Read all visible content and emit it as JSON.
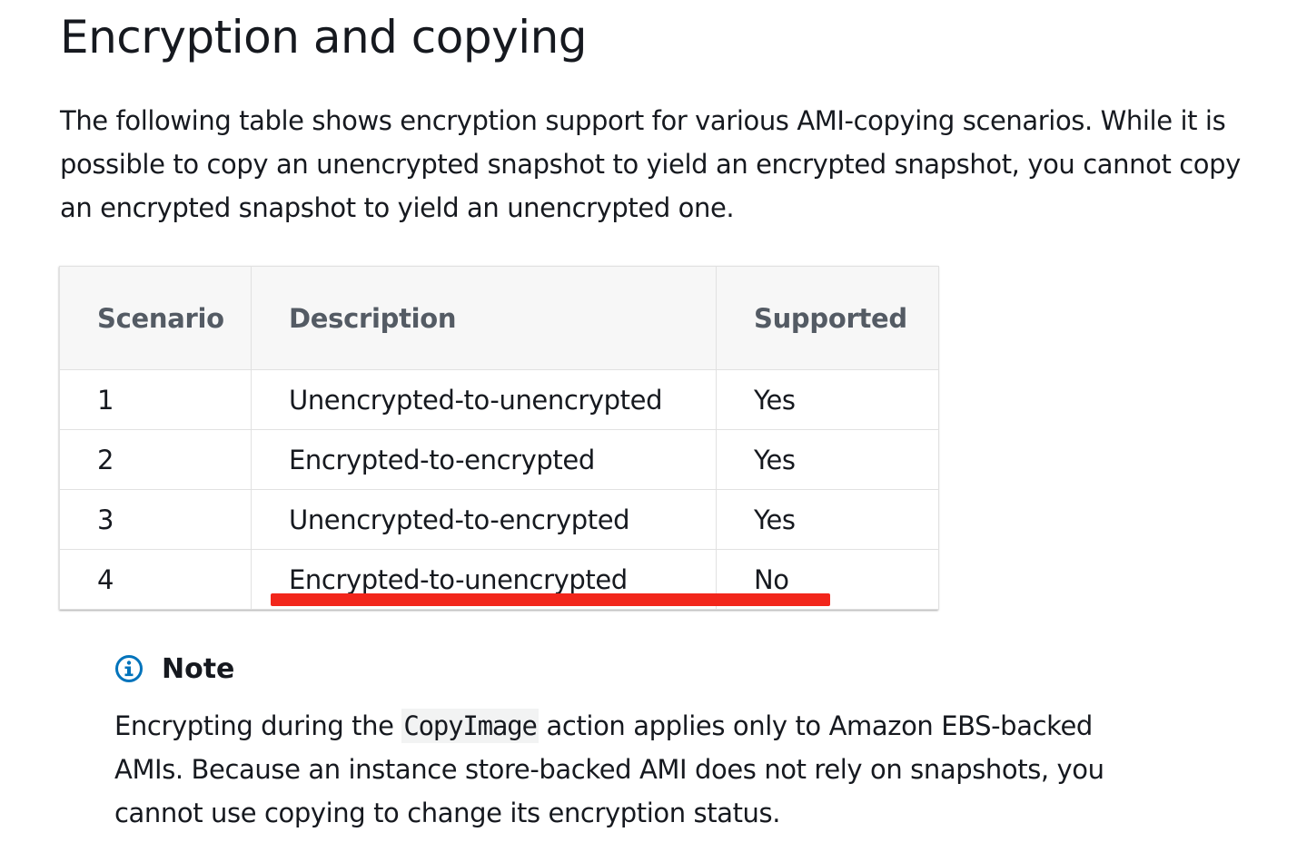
{
  "page": {
    "title": "Encryption and copying",
    "intro": "The following table shows encryption support for various AMI-copying scenarios. While it is possible to copy an unencrypted snapshot to yield an encrypted snapshot, you cannot copy an encrypted snapshot to yield an unencrypted one."
  },
  "table": {
    "headers": [
      "Scenario",
      "Description",
      "Supported"
    ],
    "rows": [
      {
        "scenario": "1",
        "description": "Unencrypted-to-unencrypted",
        "supported": "Yes"
      },
      {
        "scenario": "2",
        "description": "Encrypted-to-encrypted",
        "supported": "Yes"
      },
      {
        "scenario": "3",
        "description": "Unencrypted-to-encrypted",
        "supported": "Yes"
      },
      {
        "scenario": "4",
        "description": "Encrypted-to-unencrypted",
        "supported": "No"
      }
    ],
    "highlight_color": "#f2261b"
  },
  "note": {
    "icon": "info-icon",
    "icon_color": "#0073bb",
    "title": "Note",
    "body_before": "Encrypting during the ",
    "code": "CopyImage",
    "body_after": " action applies only to Amazon EBS-backed AMIs. Because an instance store-backed AMI does not rely on snapshots, you cannot use copying to change its encryption status."
  }
}
